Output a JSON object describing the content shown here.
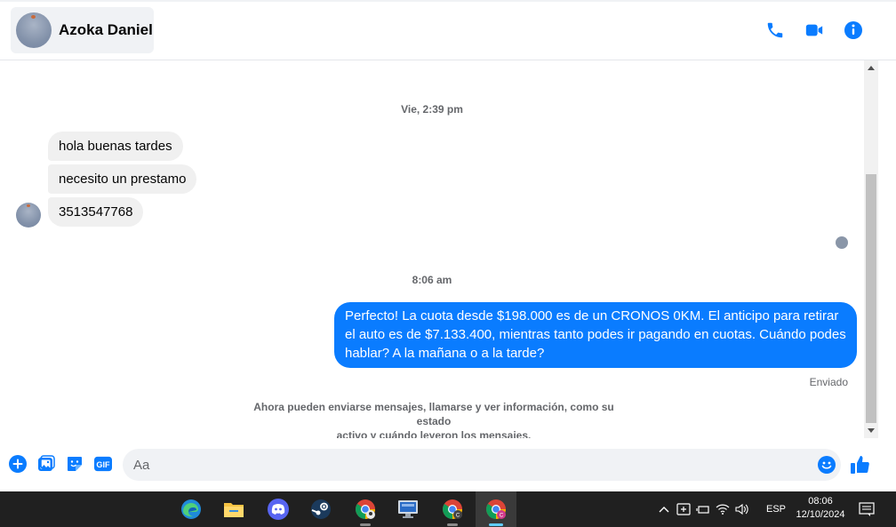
{
  "header": {
    "contact_name": "Azoka Daniel",
    "accent_color": "#0a7cff"
  },
  "messages": {
    "timestamp_1": "Vie, 2:39 pm",
    "incoming": [
      {
        "text": "hola buenas tardes"
      },
      {
        "text": "necesito un prestamo"
      },
      {
        "text": "3513547768"
      }
    ],
    "timestamp_2": "8:06 am",
    "outgoing": {
      "text": "Perfecto! La cuota desde $198.000 es de un CRONOS 0KM. El anticipo para retirar el auto es de $7.133.400, mientras tanto podes ir pagando en cuotas. Cuándo podes hablar? A la mañana o a la tarde?",
      "status": "Enviado"
    },
    "system_note_line1": "Ahora pueden enviarse mensajes, llamarse y ver información, como su estado",
    "system_note_line2": "activo y cuándo leyeron los mensajes."
  },
  "composer": {
    "placeholder": "Aa",
    "value": ""
  },
  "taskbar": {
    "language": "ESP",
    "time": "08:06",
    "date": "12/10/2024"
  }
}
